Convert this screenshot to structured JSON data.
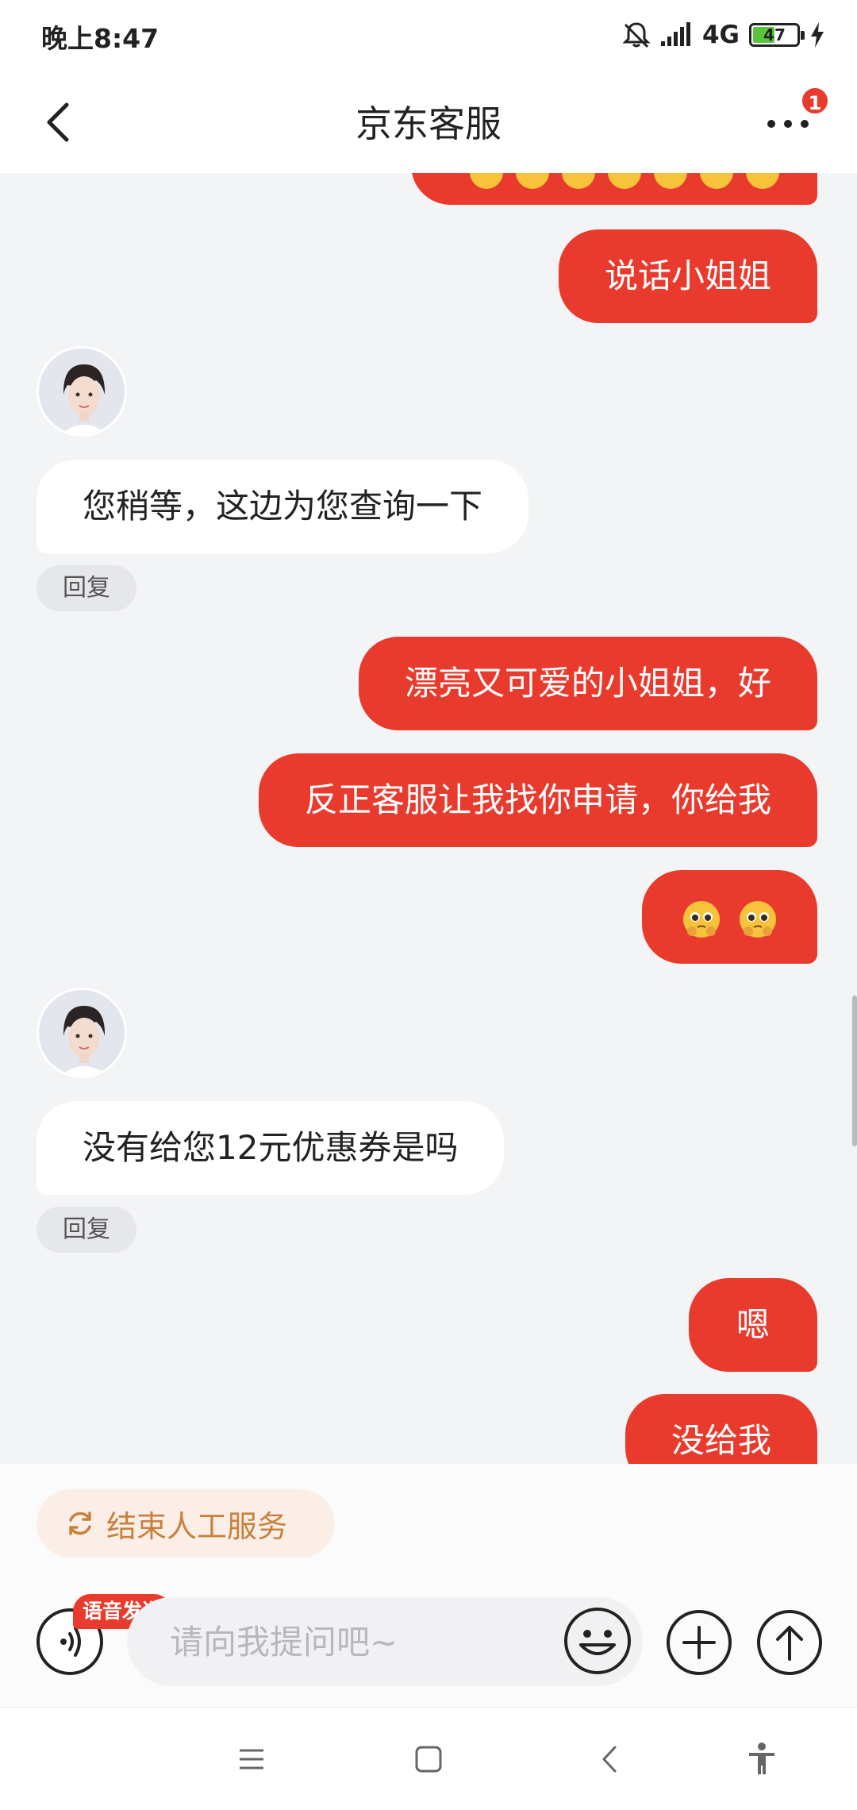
{
  "status_bar": {
    "time": "晚上8:47",
    "network": "4G",
    "battery": "47",
    "battery_level": 0.47
  },
  "header": {
    "title": "京东客服",
    "notification_count": "1"
  },
  "messages": {
    "m1": "说话小姐姐",
    "m2": "您稍等，这边为您查询一下",
    "m3": "漂亮又可爱的小姐姐，好",
    "m4": "反正客服让我找你申请，你给我",
    "m6": "没有给您12元优惠券是吗",
    "m7": "嗯",
    "m8": "没给我"
  },
  "reply_label": "回复",
  "bottom": {
    "end_service_label": "结束人工服务",
    "voice_tag": "语音发送",
    "input_placeholder": "请向我提问吧~"
  },
  "colors": {
    "accent": "#e93b2d",
    "chip_text": "#c8813c",
    "chip_bg": "#fbeee6"
  },
  "icons": {
    "back": "back-arrow-icon",
    "more": "more-dots-icon",
    "voice": "voice-icon",
    "emoji": "emoji-icon",
    "plus": "plus-icon",
    "send": "send-arrow-icon",
    "refresh": "refresh-icon"
  }
}
